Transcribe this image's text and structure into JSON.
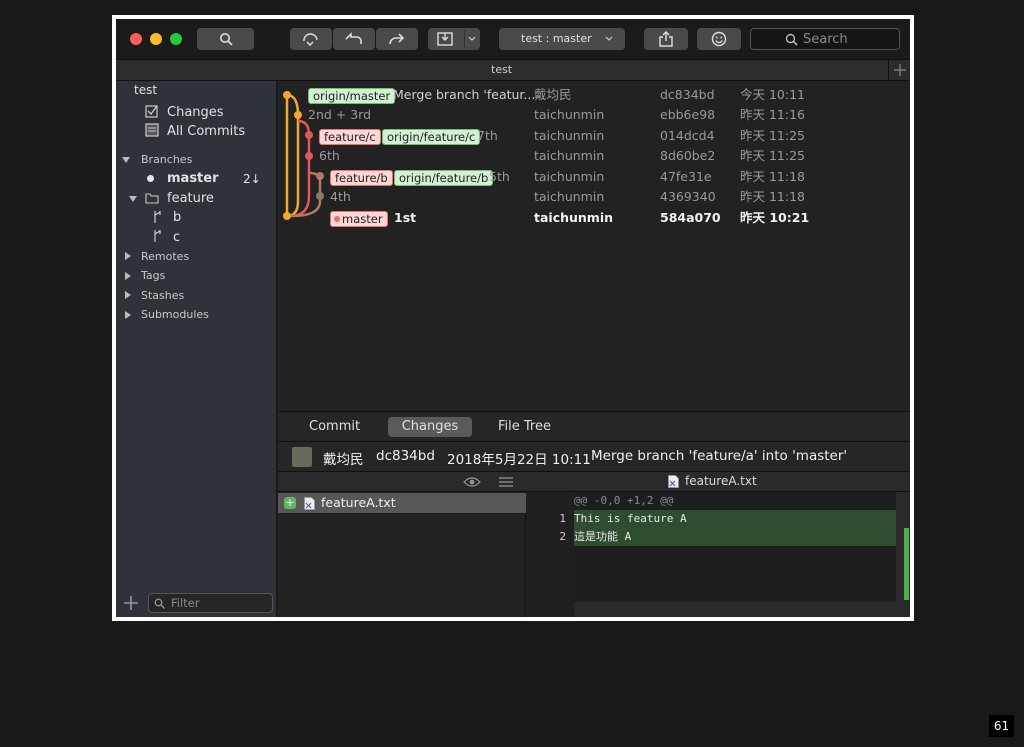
{
  "window": {
    "title": "test",
    "toolbar": {
      "branch_selector": "test :  master",
      "search_placeholder": "Search",
      "icons": [
        "search-icon",
        "fetch-icon",
        "pull-icon",
        "push-icon",
        "stash-icon",
        "chevron-down-icon",
        "share-icon",
        "smiley-icon",
        "add-tab-icon"
      ]
    }
  },
  "sidebar": {
    "repo": "test",
    "changes": "Changes",
    "all_commits": "All Commits",
    "branches_header": "Branches",
    "master": "master",
    "master_badge": "2↓",
    "feature_folder": "feature",
    "feature_b": "b",
    "feature_c": "c",
    "remotes": "Remotes",
    "tags": "Tags",
    "stashes": "Stashes",
    "submodules": "Submodules",
    "filter_placeholder": "Filter"
  },
  "commits": [
    {
      "tags": [
        "origin/master"
      ],
      "message": "Merge branch 'featur...",
      "author": "戴均民",
      "hash": "dc834bd",
      "date": "今天 10:11"
    },
    {
      "tags": [],
      "message": "2nd + 3rd",
      "author": "taichunmin",
      "hash": "ebb6e98",
      "date": "昨天 11:16"
    },
    {
      "tags": [
        "feature/c",
        "origin/feature/c"
      ],
      "message": "7th",
      "author": "taichunmin",
      "hash": "014dcd4",
      "date": "昨天 11:25"
    },
    {
      "tags": [],
      "message": "6th",
      "author": "taichunmin",
      "hash": "8d60be2",
      "date": "昨天 11:25"
    },
    {
      "tags": [
        "feature/b",
        "origin/feature/b"
      ],
      "message": "5th",
      "author": "taichunmin",
      "hash": "47fe31e",
      "date": "昨天 11:18"
    },
    {
      "tags": [],
      "message": "4th",
      "author": "taichunmin",
      "hash": "4369340",
      "date": "昨天 11:18"
    },
    {
      "tags": [
        "master"
      ],
      "message": "1st",
      "author": "taichunmin",
      "hash": "584a070",
      "date": "昨天 10:21"
    }
  ],
  "bottom_tabs": {
    "commit": "Commit",
    "changes": "Changes",
    "file_tree": "File Tree",
    "active": "Changes"
  },
  "commit_info": {
    "author": "戴均民",
    "hash": "dc834bd",
    "date": "2018年5月22日 10:11",
    "message": "Merge branch 'feature/a' into 'master'"
  },
  "files": [
    {
      "name": "featureA.txt",
      "status": "added"
    }
  ],
  "diff": {
    "file": "featureA.txt",
    "hunk": "@@ -0,0 +1,2 @@",
    "lines": [
      {
        "num": "1",
        "text": "This is feature A"
      },
      {
        "num": "2",
        "text": "這是功能 A"
      }
    ]
  },
  "slide_number": "61",
  "colors": {
    "added_bg": "#2f4d2f",
    "accent_green": "#6cc36c",
    "accent_red": "#e57373",
    "branch_yellow": "#f0a830"
  }
}
